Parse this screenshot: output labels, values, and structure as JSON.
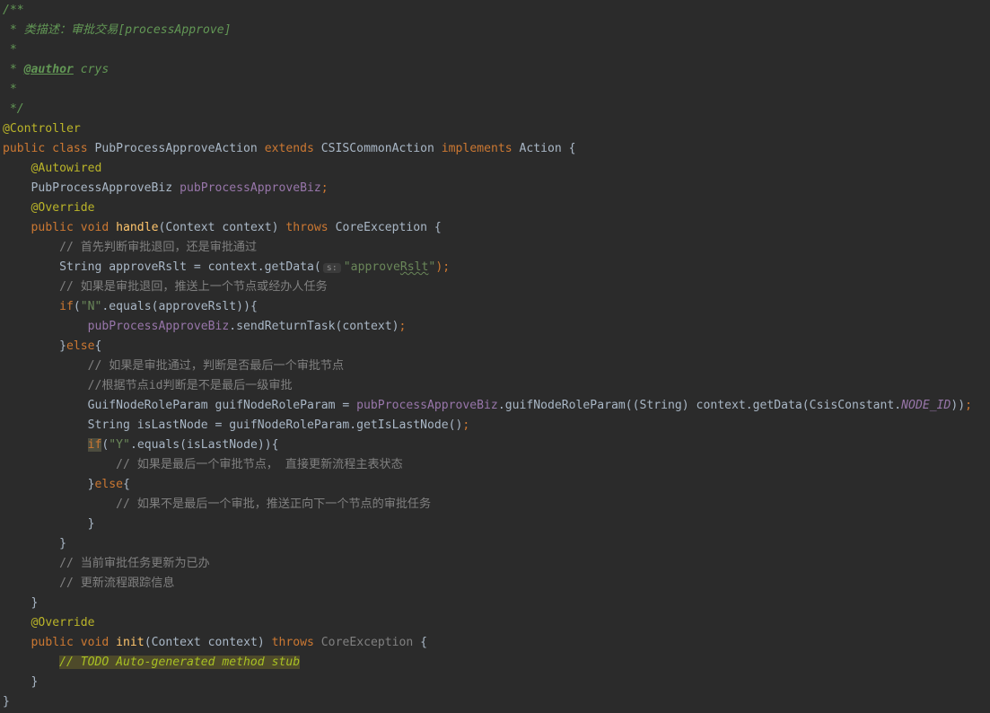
{
  "editor": {
    "theme": "darcula",
    "colors": {
      "background": "#2b2b2b",
      "text": "#a9b7c6",
      "keyword": "#cc7832",
      "annotation": "#bbb529",
      "comment": "#808080",
      "doc_comment": "#629755",
      "string": "#6a8759",
      "field": "#9876aa",
      "method": "#ffc66d"
    },
    "lines": [
      [
        {
          "t": "/**",
          "c": "doc"
        }
      ],
      [
        {
          "t": " * 类描述：审批交易[processApprove]",
          "c": "doc"
        }
      ],
      [
        {
          "t": " *",
          "c": "doc"
        }
      ],
      [
        {
          "t": " * ",
          "c": "doc"
        },
        {
          "t": "@author",
          "c": "doctag"
        },
        {
          "t": " crys",
          "c": "doc"
        }
      ],
      [
        {
          "t": " *",
          "c": "doc"
        }
      ],
      [
        {
          "t": " */",
          "c": "doc"
        }
      ],
      [
        {
          "t": "@Controller",
          "c": "annotation"
        }
      ],
      [
        {
          "t": "public class ",
          "c": "keyword"
        },
        {
          "t": "PubProcessApproveAction ",
          "c": "default"
        },
        {
          "t": "extends ",
          "c": "keyword"
        },
        {
          "t": "CSISCommonAction ",
          "c": "default"
        },
        {
          "t": "implements ",
          "c": "keyword"
        },
        {
          "t": "Action {",
          "c": "default"
        }
      ],
      [
        {
          "t": "    ",
          "c": "default"
        },
        {
          "t": "@Autowired",
          "c": "annotation"
        }
      ],
      [
        {
          "t": "    PubProcessApproveBiz ",
          "c": "default"
        },
        {
          "t": "pubProcessApproveBiz",
          "c": "field"
        },
        {
          "t": ";",
          "c": "keyword"
        }
      ],
      [
        {
          "t": "    ",
          "c": "default"
        },
        {
          "t": "@Override",
          "c": "annotation"
        }
      ],
      [
        {
          "t": "    ",
          "c": "default"
        },
        {
          "t": "public void ",
          "c": "keyword"
        },
        {
          "t": "handle",
          "c": "method"
        },
        {
          "t": "(Context context) ",
          "c": "default"
        },
        {
          "t": "throws ",
          "c": "keyword"
        },
        {
          "t": "CoreException {",
          "c": "default"
        }
      ],
      [
        {
          "t": "        // 首先判断审批退回，还是审批通过",
          "c": "comment"
        }
      ],
      [
        {
          "t": "        String approveRslt = context.getData(",
          "c": "default"
        },
        {
          "t": "s:",
          "c": "hint"
        },
        {
          "t": "\"approve",
          "c": "string"
        },
        {
          "t": "Rslt",
          "c": "string",
          "sq": true
        },
        {
          "t": "\"",
          "c": "string"
        },
        {
          "t": ");",
          "c": "keyword"
        }
      ],
      [
        {
          "t": "        // 如果是审批退回，推送上一个节点或经办人任务",
          "c": "comment"
        }
      ],
      [
        {
          "t": "        ",
          "c": "default"
        },
        {
          "t": "if",
          "c": "keyword"
        },
        {
          "t": "(",
          "c": "default"
        },
        {
          "t": "\"N\"",
          "c": "string"
        },
        {
          "t": ".equals(approveRslt)){",
          "c": "default"
        }
      ],
      [
        {
          "t": "            ",
          "c": "default"
        },
        {
          "t": "pubProcessApproveBiz",
          "c": "field"
        },
        {
          "t": ".sendReturnTask(context)",
          "c": "default"
        },
        {
          "t": ";",
          "c": "keyword"
        }
      ],
      [
        {
          "t": "        }",
          "c": "default"
        },
        {
          "t": "else",
          "c": "keyword"
        },
        {
          "t": "{",
          "c": "default"
        }
      ],
      [
        {
          "t": "            // 如果是审批通过，判断是否最后一个审批节点",
          "c": "comment"
        }
      ],
      [
        {
          "t": "            //根据节点id判断是不是最后一级审批",
          "c": "comment"
        }
      ],
      [
        {
          "t": "            GuifNodeRoleParam guifNodeRoleParam = ",
          "c": "default"
        },
        {
          "t": "pubProcessApproveBiz",
          "c": "field"
        },
        {
          "t": ".guifNodeRoleParam((String) context.getData(CsisConstant.",
          "c": "default"
        },
        {
          "t": "NODE_ID",
          "c": "static"
        },
        {
          "t": "))",
          "c": "default"
        },
        {
          "t": ";",
          "c": "keyword"
        }
      ],
      [
        {
          "t": "            String isLastNode = guifNodeRoleParam.getIsLastNode()",
          "c": "default"
        },
        {
          "t": ";",
          "c": "keyword"
        }
      ],
      [
        {
          "t": "            ",
          "c": "default"
        },
        {
          "t": "if",
          "c": "keyword",
          "hl": "if"
        },
        {
          "t": "(",
          "c": "default"
        },
        {
          "t": "\"Y\"",
          "c": "string"
        },
        {
          "t": ".equals(isLastNode)){",
          "c": "default"
        }
      ],
      [
        {
          "t": "                // 如果是最后一个审批节点， 直接更新流程主表状态",
          "c": "comment"
        }
      ],
      [
        {
          "t": "            }",
          "c": "default"
        },
        {
          "t": "else",
          "c": "keyword"
        },
        {
          "t": "{",
          "c": "default"
        }
      ],
      [
        {
          "t": "                // 如果不是最后一个审批，推送正向下一个节点的审批任务",
          "c": "comment"
        }
      ],
      [
        {
          "t": "            }",
          "c": "default"
        }
      ],
      [
        {
          "t": "        }",
          "c": "default"
        }
      ],
      [
        {
          "t": "        // 当前审批任务更新为已办",
          "c": "comment"
        }
      ],
      [
        {
          "t": "        // 更新流程跟踪信息",
          "c": "comment"
        }
      ],
      [
        {
          "t": "    }",
          "c": "default"
        }
      ],
      [
        {
          "t": "    ",
          "c": "default"
        },
        {
          "t": "@Override",
          "c": "annotation"
        }
      ],
      [
        {
          "t": "    ",
          "c": "default"
        },
        {
          "t": "public void ",
          "c": "keyword"
        },
        {
          "t": "init",
          "c": "method"
        },
        {
          "t": "(Context context) ",
          "c": "default"
        },
        {
          "t": "throws ",
          "c": "keyword"
        },
        {
          "t": "CoreException ",
          "c": "dim"
        },
        {
          "t": "{",
          "c": "default"
        }
      ],
      [
        {
          "t": "        ",
          "c": "default"
        },
        {
          "t": "// TODO Auto-generated method stub",
          "c": "todo",
          "hl": "todo"
        }
      ],
      [
        {
          "t": "    }",
          "c": "default"
        }
      ],
      [
        {
          "t": "}",
          "c": "default"
        }
      ]
    ]
  }
}
